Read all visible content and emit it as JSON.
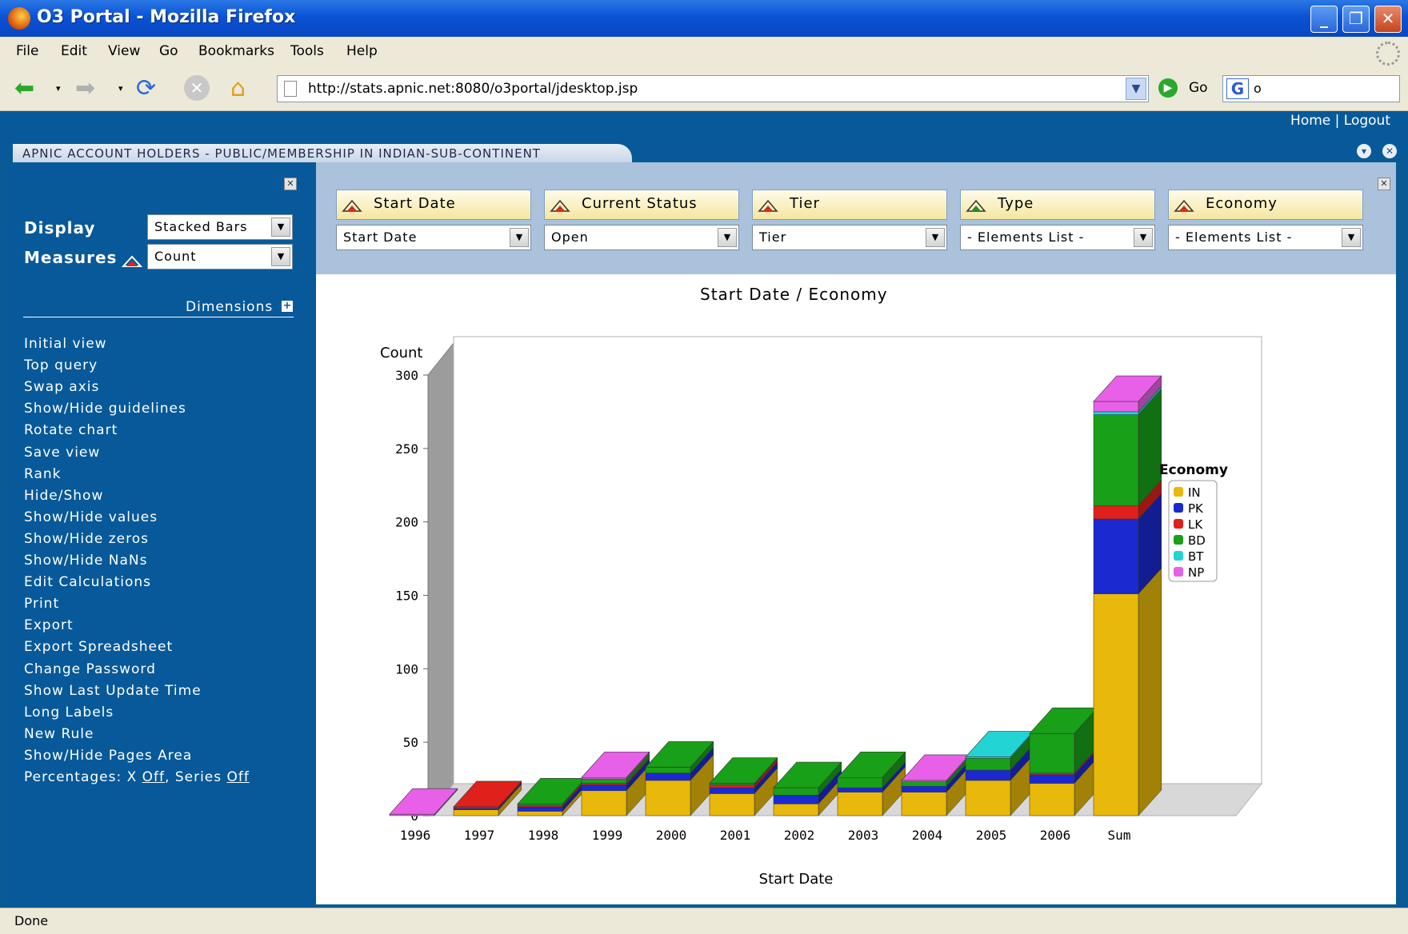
{
  "window": {
    "title": "O3 Portal - Mozilla Firefox"
  },
  "menubar": {
    "items": [
      "File",
      "Edit",
      "View",
      "Go",
      "Bookmarks",
      "Tools",
      "Help"
    ]
  },
  "navbar": {
    "url": "http://stats.apnic.net:8080/o3portal/jdesktop.jsp",
    "go_label": "Go",
    "search_value": "o"
  },
  "portal": {
    "home": "Home",
    "separator": "|",
    "logout": "Logout",
    "tab_title": "APNIC ACCOUNT HOLDERS - PUBLIC/MEMBERSHIP IN INDIAN-SUB-CONTINENT"
  },
  "left": {
    "display_label": "Display",
    "display_value": "Stacked Bars",
    "measures_label": "Measures",
    "measures_value": "Count",
    "dimensions_label": "Dimensions",
    "menu": [
      "Initial view",
      "Top query",
      "Swap axis",
      "Show/Hide guidelines",
      "Rotate chart",
      "Save view",
      "Rank",
      "Hide/Show",
      "Show/Hide values",
      "Show/Hide zeros",
      "Show/Hide NaNs",
      "Edit Calculations",
      "Print",
      "Export",
      "Export Spreadsheet",
      "Change Password",
      "Show Last Update Time",
      "Long Labels",
      "New Rule",
      "Show/Hide Pages Area"
    ],
    "percentages": {
      "prefix": "Percentages: X",
      "x_state": "Off",
      "series_label": ", Series",
      "series_state": "Off"
    }
  },
  "filters": [
    {
      "header": "Start Date",
      "value": "Start Date",
      "icon_color": "#d42a1a"
    },
    {
      "header": "Current Status",
      "value": "Open",
      "icon_color": "#d42a1a"
    },
    {
      "header": "Tier",
      "value": "Tier",
      "icon_color": "#d42a1a"
    },
    {
      "header": "Type",
      "value": "- Elements List -",
      "icon_color": "#2a8a2a"
    },
    {
      "header": "Economy",
      "value": "- Elements List -",
      "icon_color": "#d42a1a"
    }
  ],
  "chart_data": {
    "type": "bar",
    "stacked": true,
    "title": "Start Date / Economy",
    "xlabel": "Start Date",
    "ylabel": "Count",
    "ylim": [
      0,
      300
    ],
    "yticks": [
      0,
      50,
      100,
      150,
      200,
      250,
      300
    ],
    "grid": false,
    "legend_title": "Economy",
    "legend_position": "right",
    "categories": [
      "1996",
      "1997",
      "1998",
      "1999",
      "2000",
      "2001",
      "2002",
      "2003",
      "2004",
      "2005",
      "2006",
      "Sum"
    ],
    "series": [
      {
        "name": "IN",
        "color": "#e8b80a",
        "values": [
          0,
          4,
          3,
          17,
          24,
          15,
          8,
          16,
          16,
          24,
          22,
          151
        ]
      },
      {
        "name": "PK",
        "color": "#1a2ad0",
        "values": [
          0,
          1,
          3,
          4,
          5,
          4,
          6,
          3,
          4,
          7,
          6,
          51
        ]
      },
      {
        "name": "LK",
        "color": "#e0201a",
        "values": [
          0,
          1,
          1,
          1,
          0,
          2,
          0,
          0,
          0,
          0,
          1,
          9
        ]
      },
      {
        "name": "BD",
        "color": "#18a018",
        "values": [
          0,
          0,
          1,
          3,
          4,
          1,
          5,
          7,
          3,
          8,
          27,
          62
        ]
      },
      {
        "name": "BT",
        "color": "#22d4d4",
        "values": [
          0,
          0,
          0,
          0,
          0,
          0,
          0,
          0,
          0,
          1,
          0,
          2
        ]
      },
      {
        "name": "NP",
        "color": "#e860e8",
        "values": [
          1,
          0,
          0,
          1,
          0,
          0,
          0,
          0,
          1,
          0,
          0,
          7
        ]
      }
    ]
  },
  "status": {
    "text": "Done"
  }
}
